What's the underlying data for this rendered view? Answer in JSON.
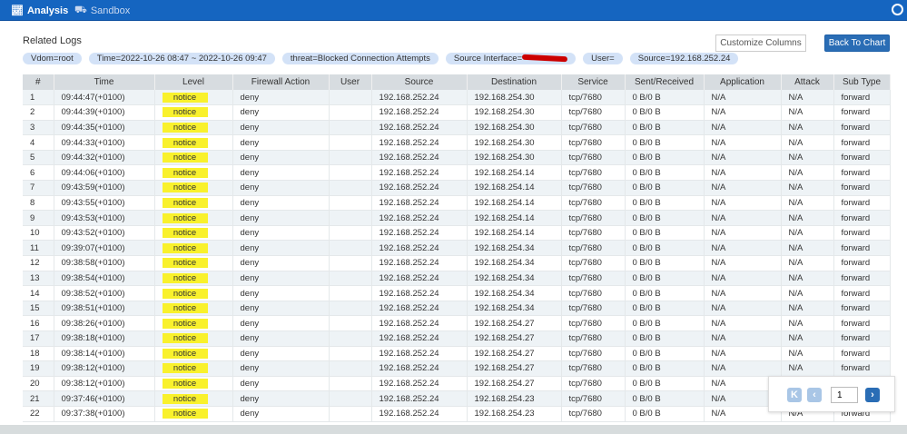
{
  "nav": {
    "analysis": "Analysis",
    "sandbox": "Sandbox"
  },
  "page": {
    "title": "Related Logs"
  },
  "filters": [
    "Vdom=root",
    "Time=2022-10-26 08:47 ~ 2022-10-26 09:47",
    "threat=Blocked Connection Attempts",
    "Source Interface=",
    "User=",
    "Source=192.168.252.24"
  ],
  "buttons": {
    "customize": "Customize Columns",
    "back": "Back To Chart"
  },
  "colors": {
    "accent": "#1565c0",
    "level_notice": "#f9f12c"
  },
  "columns": [
    "#",
    "Time",
    "Level",
    "Firewall Action",
    "User",
    "Source",
    "Destination",
    "Service",
    "Sent/Received",
    "Application",
    "Attack",
    "Sub Type"
  ],
  "rows": [
    [
      "1",
      "09:44:47(+0100)",
      "notice",
      "deny",
      "",
      "192.168.252.24",
      "192.168.254.30",
      "tcp/7680",
      "0 B/0 B",
      "N/A",
      "N/A",
      "forward"
    ],
    [
      "2",
      "09:44:39(+0100)",
      "notice",
      "deny",
      "",
      "192.168.252.24",
      "192.168.254.30",
      "tcp/7680",
      "0 B/0 B",
      "N/A",
      "N/A",
      "forward"
    ],
    [
      "3",
      "09:44:35(+0100)",
      "notice",
      "deny",
      "",
      "192.168.252.24",
      "192.168.254.30",
      "tcp/7680",
      "0 B/0 B",
      "N/A",
      "N/A",
      "forward"
    ],
    [
      "4",
      "09:44:33(+0100)",
      "notice",
      "deny",
      "",
      "192.168.252.24",
      "192.168.254.30",
      "tcp/7680",
      "0 B/0 B",
      "N/A",
      "N/A",
      "forward"
    ],
    [
      "5",
      "09:44:32(+0100)",
      "notice",
      "deny",
      "",
      "192.168.252.24",
      "192.168.254.30",
      "tcp/7680",
      "0 B/0 B",
      "N/A",
      "N/A",
      "forward"
    ],
    [
      "6",
      "09:44:06(+0100)",
      "notice",
      "deny",
      "",
      "192.168.252.24",
      "192.168.254.14",
      "tcp/7680",
      "0 B/0 B",
      "N/A",
      "N/A",
      "forward"
    ],
    [
      "7",
      "09:43:59(+0100)",
      "notice",
      "deny",
      "",
      "192.168.252.24",
      "192.168.254.14",
      "tcp/7680",
      "0 B/0 B",
      "N/A",
      "N/A",
      "forward"
    ],
    [
      "8",
      "09:43:55(+0100)",
      "notice",
      "deny",
      "",
      "192.168.252.24",
      "192.168.254.14",
      "tcp/7680",
      "0 B/0 B",
      "N/A",
      "N/A",
      "forward"
    ],
    [
      "9",
      "09:43:53(+0100)",
      "notice",
      "deny",
      "",
      "192.168.252.24",
      "192.168.254.14",
      "tcp/7680",
      "0 B/0 B",
      "N/A",
      "N/A",
      "forward"
    ],
    [
      "10",
      "09:43:52(+0100)",
      "notice",
      "deny",
      "",
      "192.168.252.24",
      "192.168.254.14",
      "tcp/7680",
      "0 B/0 B",
      "N/A",
      "N/A",
      "forward"
    ],
    [
      "11",
      "09:39:07(+0100)",
      "notice",
      "deny",
      "",
      "192.168.252.24",
      "192.168.254.34",
      "tcp/7680",
      "0 B/0 B",
      "N/A",
      "N/A",
      "forward"
    ],
    [
      "12",
      "09:38:58(+0100)",
      "notice",
      "deny",
      "",
      "192.168.252.24",
      "192.168.254.34",
      "tcp/7680",
      "0 B/0 B",
      "N/A",
      "N/A",
      "forward"
    ],
    [
      "13",
      "09:38:54(+0100)",
      "notice",
      "deny",
      "",
      "192.168.252.24",
      "192.168.254.34",
      "tcp/7680",
      "0 B/0 B",
      "N/A",
      "N/A",
      "forward"
    ],
    [
      "14",
      "09:38:52(+0100)",
      "notice",
      "deny",
      "",
      "192.168.252.24",
      "192.168.254.34",
      "tcp/7680",
      "0 B/0 B",
      "N/A",
      "N/A",
      "forward"
    ],
    [
      "15",
      "09:38:51(+0100)",
      "notice",
      "deny",
      "",
      "192.168.252.24",
      "192.168.254.34",
      "tcp/7680",
      "0 B/0 B",
      "N/A",
      "N/A",
      "forward"
    ],
    [
      "16",
      "09:38:26(+0100)",
      "notice",
      "deny",
      "",
      "192.168.252.24",
      "192.168.254.27",
      "tcp/7680",
      "0 B/0 B",
      "N/A",
      "N/A",
      "forward"
    ],
    [
      "17",
      "09:38:18(+0100)",
      "notice",
      "deny",
      "",
      "192.168.252.24",
      "192.168.254.27",
      "tcp/7680",
      "0 B/0 B",
      "N/A",
      "N/A",
      "forward"
    ],
    [
      "18",
      "09:38:14(+0100)",
      "notice",
      "deny",
      "",
      "192.168.252.24",
      "192.168.254.27",
      "tcp/7680",
      "0 B/0 B",
      "N/A",
      "N/A",
      "forward"
    ],
    [
      "19",
      "09:38:12(+0100)",
      "notice",
      "deny",
      "",
      "192.168.252.24",
      "192.168.254.27",
      "tcp/7680",
      "0 B/0 B",
      "N/A",
      "N/A",
      "forward"
    ],
    [
      "20",
      "09:38:12(+0100)",
      "notice",
      "deny",
      "",
      "192.168.252.24",
      "192.168.254.27",
      "tcp/7680",
      "0 B/0 B",
      "N/A",
      "N/A",
      "forward"
    ],
    [
      "21",
      "09:37:46(+0100)",
      "notice",
      "deny",
      "",
      "192.168.252.24",
      "192.168.254.23",
      "tcp/7680",
      "0 B/0 B",
      "N/A",
      "N/A",
      "forward"
    ],
    [
      "22",
      "09:37:38(+0100)",
      "notice",
      "deny",
      "",
      "192.168.252.24",
      "192.168.254.23",
      "tcp/7680",
      "0 B/0 B",
      "N/A",
      "N/A",
      "forward"
    ]
  ],
  "pager": {
    "page": "1"
  }
}
